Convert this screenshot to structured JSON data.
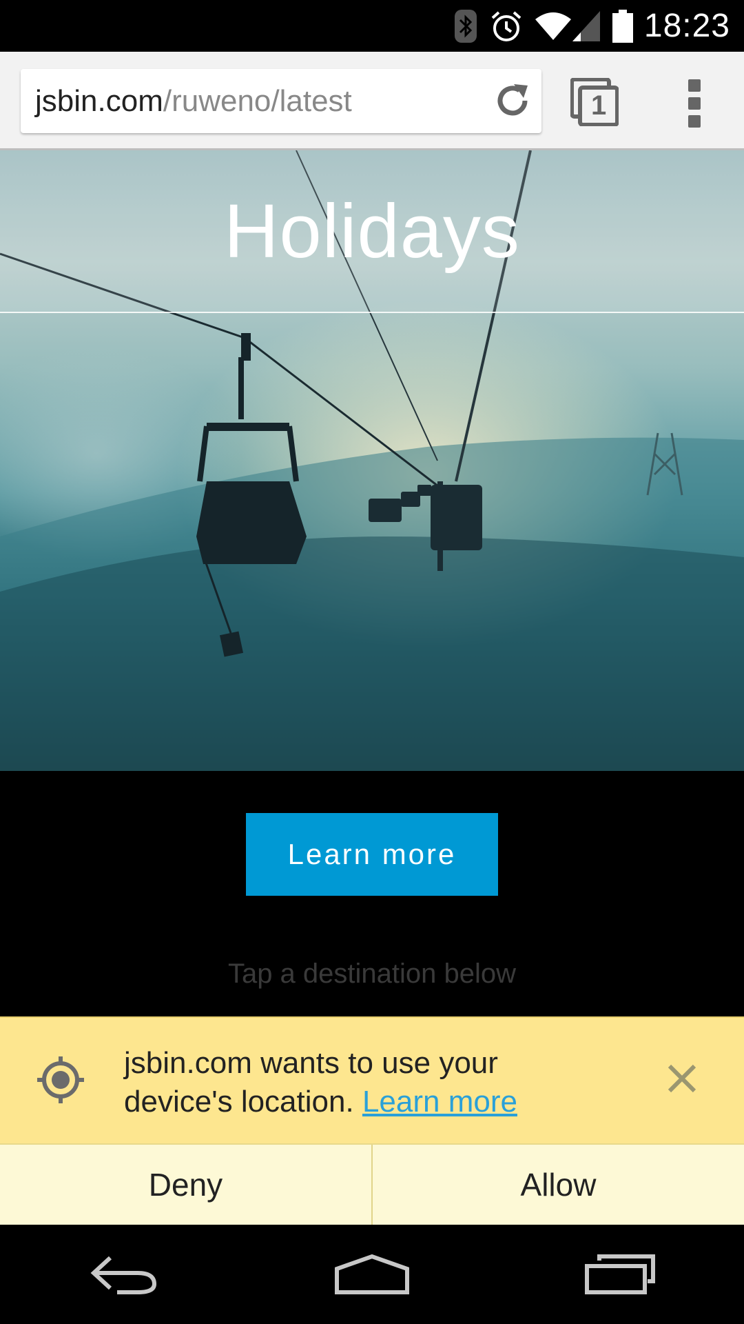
{
  "status_bar": {
    "time": "18:23",
    "icons": [
      "bluetooth-icon",
      "alarm-icon",
      "wifi-icon",
      "cell-signal-icon",
      "battery-icon"
    ]
  },
  "browser": {
    "url_domain": "jsbin.com",
    "url_path": "/ruweno/latest",
    "tab_count": "1"
  },
  "hero": {
    "title": "Holidays"
  },
  "cta": {
    "label": "Learn more",
    "color": "#0099d4"
  },
  "hint": "Tap a destination below",
  "infobar": {
    "message": "jsbin.com wants to use your device's location.",
    "link": "Learn more",
    "deny_label": "Deny",
    "allow_label": "Allow",
    "background": "#fde68f"
  },
  "navbar": {
    "icons": [
      "back-icon",
      "home-icon",
      "recents-icon"
    ]
  }
}
